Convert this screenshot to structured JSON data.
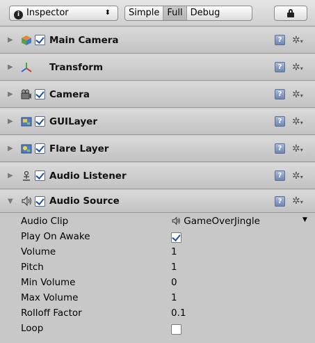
{
  "toolbar": {
    "inspector_label": "Inspector",
    "inspector_arrows": "⬍",
    "modes": [
      "Simple",
      "Full",
      "Debug"
    ],
    "active_mode": "Full"
  },
  "components": [
    {
      "label": "Main Camera",
      "icon": "gameobject-cube-icon",
      "checkbox": true,
      "expanded": false
    },
    {
      "label": "Transform",
      "icon": "transform-axes-icon",
      "checkbox": null,
      "expanded": false
    },
    {
      "label": "Camera",
      "icon": "camera-icon",
      "checkbox": true,
      "expanded": false
    },
    {
      "label": "GUILayer",
      "icon": "guilayer-icon",
      "checkbox": true,
      "expanded": false
    },
    {
      "label": "Flare Layer",
      "icon": "flare-layer-icon",
      "checkbox": true,
      "expanded": false
    },
    {
      "label": "Audio Listener",
      "icon": "audio-listener-icon",
      "checkbox": true,
      "expanded": false
    },
    {
      "label": "Audio Source",
      "icon": "audio-source-icon",
      "checkbox": true,
      "expanded": true
    }
  ],
  "audio_source": {
    "audio_clip_label": "Audio Clip",
    "audio_clip_value": "GameOverJingle",
    "play_on_awake_label": "Play On Awake",
    "play_on_awake": true,
    "volume_label": "Volume",
    "volume_value": "1",
    "pitch_label": "Pitch",
    "pitch_value": "1",
    "min_volume_label": "Min Volume",
    "min_volume_value": "0",
    "max_volume_label": "Max Volume",
    "max_volume_value": "1",
    "rolloff_label": "Rolloff Factor",
    "rolloff_value": "0.1",
    "loop_label": "Loop",
    "loop": false
  },
  "icons": {
    "help": "?",
    "gear": "✲",
    "collapsed": "▶",
    "expanded": "▼",
    "speaker": "🔈"
  }
}
